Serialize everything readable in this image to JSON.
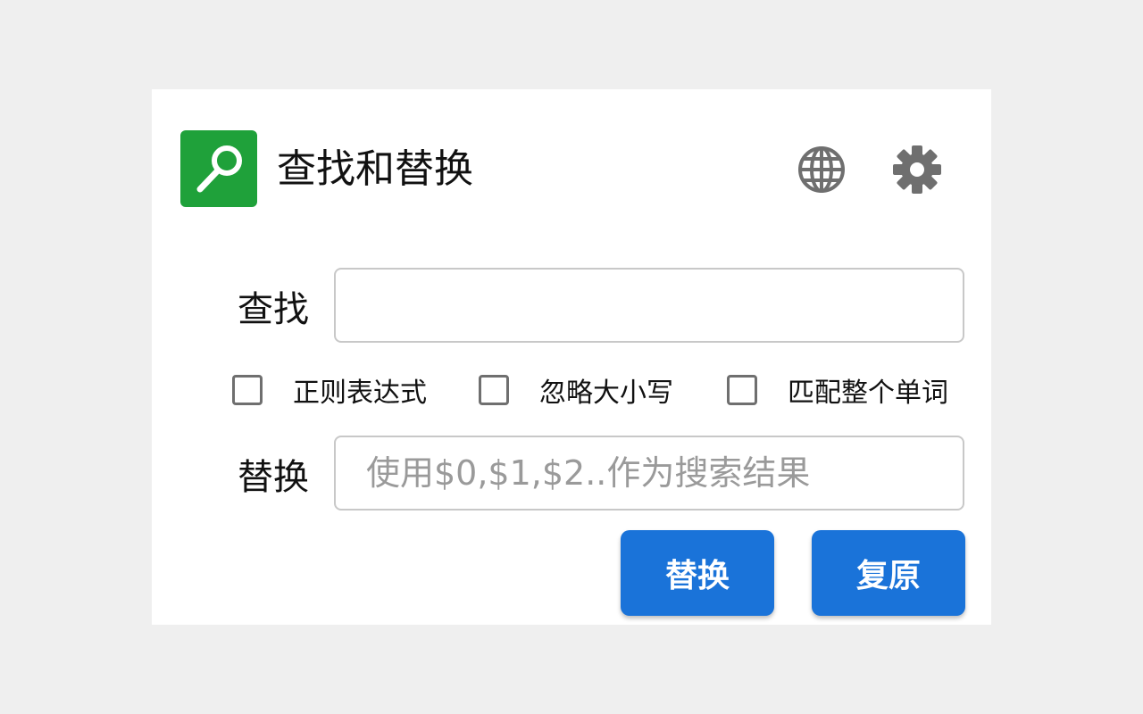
{
  "header": {
    "title": "查找和替换",
    "logo_icon": "magnifier-icon",
    "logo_color": "#1fa13a",
    "language_icon": "globe-icon",
    "settings_icon": "gear-icon"
  },
  "find": {
    "label": "查找",
    "value": "",
    "placeholder": ""
  },
  "options": [
    {
      "label": "正则表达式",
      "checked": false
    },
    {
      "label": "忽略大小写",
      "checked": false
    },
    {
      "label": "匹配整个单词",
      "checked": false
    }
  ],
  "replace": {
    "label": "替换",
    "value": "",
    "placeholder": "使用$0,$1,$2..作为搜索结果"
  },
  "buttons": {
    "replace_label": "替换",
    "restore_label": "复原",
    "color": "#1a73d9"
  }
}
